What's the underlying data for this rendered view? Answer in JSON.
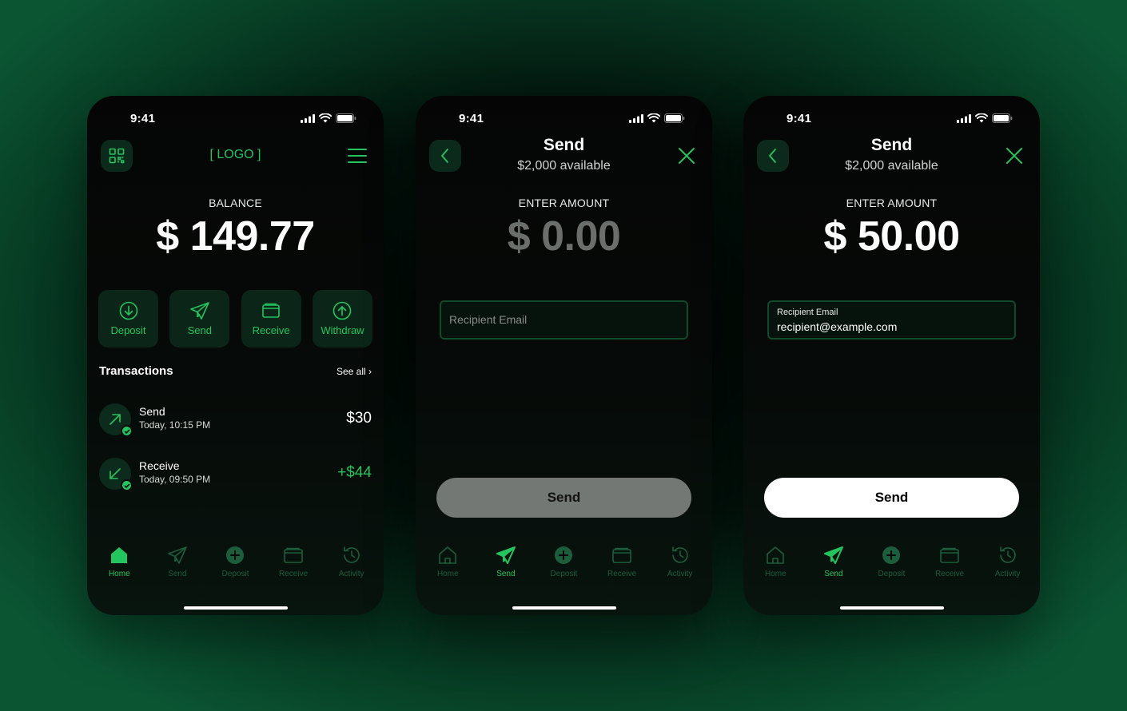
{
  "theme": {
    "accent": "#22c55e",
    "tile_bg": "#0b2519",
    "background": "#05120c"
  },
  "status_bar": {
    "time": "9:41"
  },
  "tabs": [
    {
      "label": "Home",
      "icon": "home-icon"
    },
    {
      "label": "Send",
      "icon": "paper-plane-icon"
    },
    {
      "label": "Deposit",
      "icon": "plus-circle-icon"
    },
    {
      "label": "Receive",
      "icon": "wallet-icon"
    },
    {
      "label": "Activity",
      "icon": "history-icon"
    }
  ],
  "home": {
    "logo": "[ LOGO ]",
    "balance_label": "BALANCE",
    "balance": "$ 149.77",
    "actions": [
      {
        "label": "Deposit",
        "icon": "arrow-down-circle-icon"
      },
      {
        "label": "Send",
        "icon": "paper-plane-icon"
      },
      {
        "label": "Receive",
        "icon": "wallet-icon"
      },
      {
        "label": "Withdraw",
        "icon": "arrow-up-circle-icon"
      }
    ],
    "transactions_title": "Transactions",
    "see_all": "See all ›",
    "transactions": [
      {
        "name": "Send",
        "time": "Today, 10:15 PM",
        "amount": "$30",
        "icon": "arrow-up-right-icon"
      },
      {
        "name": "Receive",
        "time": "Today, 09:50 PM",
        "amount": "+$44",
        "icon": "arrow-down-left-icon"
      }
    ],
    "active_tab": "Home"
  },
  "send_empty": {
    "title": "Send",
    "available": "$2,000 available",
    "amount_label": "ENTER AMOUNT",
    "amount": "$ 0.00",
    "recipient_placeholder": "Recipient Email",
    "send_button": "Send",
    "active_tab": "Send"
  },
  "send_filled": {
    "title": "Send",
    "available": "$2,000 available",
    "amount_label": "ENTER AMOUNT",
    "amount": "$ 50.00",
    "recipient_label": "Recipient Email",
    "recipient_value": "recipient@example.com",
    "send_button": "Send",
    "active_tab": "Send"
  }
}
